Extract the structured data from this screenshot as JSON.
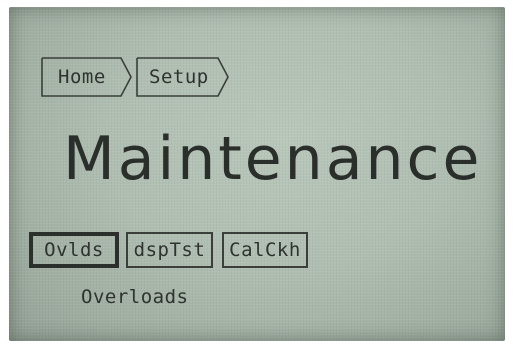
{
  "breadcrumb": {
    "items": [
      {
        "label": "Home"
      },
      {
        "label": "Setup"
      }
    ]
  },
  "title": "Maintenance",
  "softkeys": [
    {
      "label": "Ovlds",
      "selected": true
    },
    {
      "label": "dspTst",
      "selected": false
    },
    {
      "label": "CalCkh",
      "selected": false
    }
  ],
  "selected_description": "Overloads",
  "colors": {
    "screen_background": "#b0beb2",
    "pixel_dark": "#2b2f2c"
  }
}
